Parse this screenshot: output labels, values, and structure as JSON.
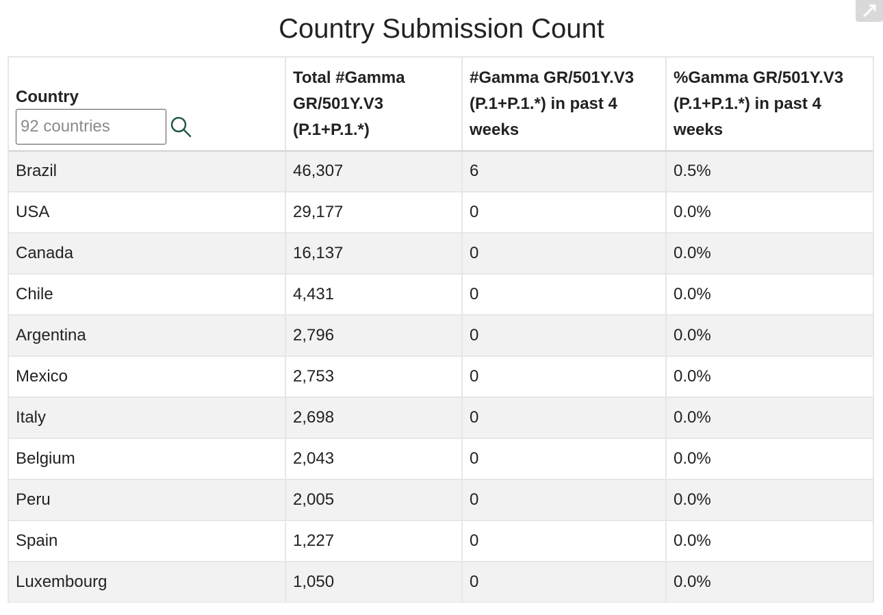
{
  "title": "Country Submission Count",
  "filter": {
    "placeholder": "92 countries"
  },
  "columns": [
    "Country",
    "Total #Gamma GR/501Y.V3 (P.1+P.1.*)",
    "#Gamma GR/501Y.V3 (P.1+P.1.*) in past 4 weeks",
    "%Gamma GR/501Y.V3 (P.1+P.1.*) in past 4 weeks"
  ],
  "rows": [
    [
      "Brazil",
      "46,307",
      "6",
      "0.5%"
    ],
    [
      "USA",
      "29,177",
      "0",
      "0.0%"
    ],
    [
      "Canada",
      "16,137",
      "0",
      "0.0%"
    ],
    [
      "Chile",
      "4,431",
      "0",
      "0.0%"
    ],
    [
      "Argentina",
      "2,796",
      "0",
      "0.0%"
    ],
    [
      "Mexico",
      "2,753",
      "0",
      "0.0%"
    ],
    [
      "Italy",
      "2,698",
      "0",
      "0.0%"
    ],
    [
      "Belgium",
      "2,043",
      "0",
      "0.0%"
    ],
    [
      "Peru",
      "2,005",
      "0",
      "0.0%"
    ],
    [
      "Spain",
      "1,227",
      "0",
      "0.0%"
    ],
    [
      "Luxembourg",
      "1,050",
      "0",
      "0.0%"
    ],
    [
      "",
      "",
      "",
      ""
    ]
  ],
  "icons": {
    "search": "search-icon",
    "corner": "expand-icon"
  },
  "colors": {
    "search_icon": "#1e5a46",
    "row_stripe": "#f2f2f2",
    "border": "#e6e6e6"
  }
}
